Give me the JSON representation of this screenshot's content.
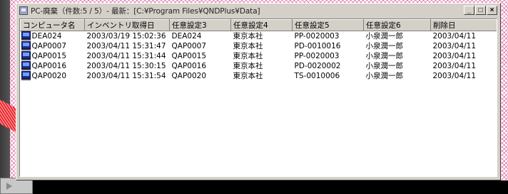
{
  "window": {
    "title": "PC-廃棄（件数:5 / 5）- 最新：[C:¥Program Files¥QNDPlus¥Data]",
    "buttons": {
      "minimize": "_",
      "maximize": "□",
      "close": "×"
    }
  },
  "list": {
    "columns": [
      "コンピュータ名",
      "インベントリ取得日",
      "任意設定3",
      "任意設定4",
      "任意設定5",
      "任意設定6",
      "削除日"
    ],
    "rows": [
      [
        "DEA024",
        "2003/03/19 15:02:36",
        "DEA024",
        "東京本社",
        "PP-0020003",
        "小泉潤一郎",
        "2003/04/11"
      ],
      [
        "QAP0007",
        "2003/04/11 15:31:47",
        "QAP0007",
        "東京本社",
        "PD-0010016",
        "小泉潤一郎",
        "2003/04/11"
      ],
      [
        "QAP0015",
        "2003/04/11 15:31:44",
        "QAP0015",
        "東京本社",
        "PP-0020003",
        "小泉潤一郎",
        "2003/04/11"
      ],
      [
        "QAP0016",
        "2003/04/11 15:30:15",
        "QAP0016",
        "東京本社",
        "PD-0020002",
        "小泉潤一郎",
        "2003/04/11"
      ],
      [
        "QAP0020",
        "2003/04/11 15:31:54",
        "QAP0020",
        "東京本社",
        "TS-0010006",
        "小泉潤一郎",
        "2003/04/11"
      ]
    ]
  },
  "colors": {
    "background_pattern": "#d63482",
    "window_face": "#d4d0c8",
    "list_background": "#ffffff",
    "decor_red": "#e2202a"
  },
  "icons": {
    "app": "app-icon",
    "row": "computer-icon"
  }
}
